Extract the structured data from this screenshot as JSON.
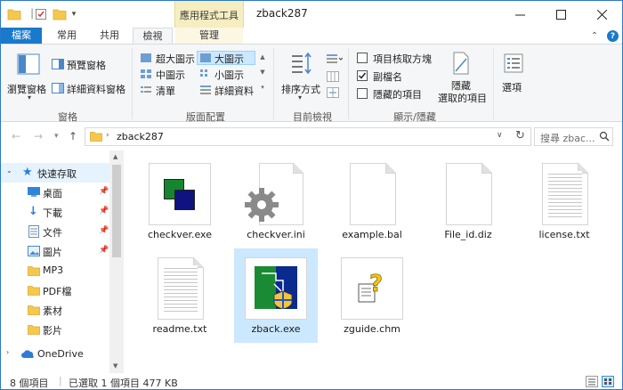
{
  "window": {
    "title": "zback287",
    "context_tab_group": "應用程式工具"
  },
  "tabs": {
    "file": "檔案",
    "home": "常用",
    "share": "共用",
    "view": "檢視",
    "manage": "管理"
  },
  "ribbon": {
    "pane": {
      "nav_pane": "瀏覽窗格",
      "preview_pane": "預覽窗格",
      "details_pane": "詳細資料窗格",
      "group": "窗格"
    },
    "layout": {
      "extra_large": "超大圖示",
      "large": "大圖示",
      "medium": "中圖示",
      "small": "小圖示",
      "list": "清單",
      "details": "詳細資料",
      "group": "版面配置"
    },
    "current_view": {
      "sort_by": "排序方式",
      "group": "目前檢視"
    },
    "show_hide": {
      "item_checkboxes": "項目核取方塊",
      "file_extensions": "副檔名",
      "hidden_items": "隱藏的項目",
      "hide_selected_line1": "隱藏",
      "hide_selected_line2": "選取的項目",
      "group": "顯示/隱藏",
      "file_extensions_checked": true,
      "item_checkboxes_checked": false,
      "hidden_items_checked": false
    },
    "options": "選項"
  },
  "address": {
    "path": "zback287",
    "search_placeholder": "搜尋 zbac..."
  },
  "nav": {
    "quick_access": "快速存取",
    "items": [
      {
        "label": "桌面",
        "pinned": true
      },
      {
        "label": "下載",
        "pinned": true
      },
      {
        "label": "文件",
        "pinned": true
      },
      {
        "label": "圖片",
        "pinned": true
      },
      {
        "label": "MP3",
        "pinned": false
      },
      {
        "label": "PDF檔",
        "pinned": false
      },
      {
        "label": "素材",
        "pinned": false
      },
      {
        "label": "影片",
        "pinned": false
      }
    ],
    "onedrive": "OneDrive"
  },
  "files": [
    {
      "name": "checkver.exe",
      "icon": "exe-squares-icon"
    },
    {
      "name": "checkver.ini",
      "icon": "ini-gear-icon"
    },
    {
      "name": "example.bal",
      "icon": "blank-document-icon"
    },
    {
      "name": "File_id.diz",
      "icon": "blank-document-icon"
    },
    {
      "name": "license.txt",
      "icon": "text-document-icon"
    },
    {
      "name": "readme.txt",
      "icon": "text-document-icon"
    },
    {
      "name": "zback.exe",
      "icon": "zback-app-icon",
      "selected": true
    },
    {
      "name": "zguide.chm",
      "icon": "help-chm-icon"
    }
  ],
  "status": {
    "item_count": "8 個項目",
    "selection": "已選取 1 個項目  477 KB"
  },
  "colors": {
    "accent": "#1979ca",
    "selection": "#cce8ff",
    "context_tab": "#f6eec1"
  }
}
